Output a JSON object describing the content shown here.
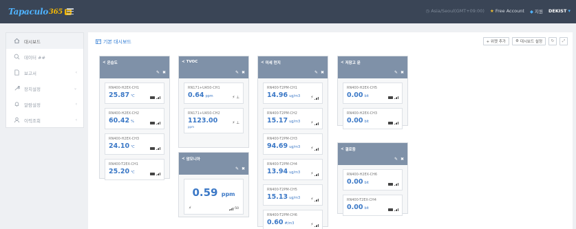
{
  "header": {
    "logo_text": "Tapaculo",
    "logo_glyph": "365",
    "logo_badge": "lo",
    "timezone": "Asia/Seoul(GMT+09:00)",
    "account": "Free Account",
    "support": "지원",
    "user": "DEKIST"
  },
  "sidebar": {
    "items": [
      {
        "label": "대시보드",
        "icon": "home-icon",
        "active": true
      },
      {
        "label": "데이터 ##",
        "icon": "search-icon"
      },
      {
        "label": "보고서",
        "icon": "document-icon"
      },
      {
        "label": "장치설정",
        "icon": "wrench-icon"
      },
      {
        "label": "알람설정",
        "icon": "bell-icon"
      },
      {
        "label": "이력조회",
        "icon": "user-icon"
      }
    ]
  },
  "main": {
    "title": "기본 대시보드",
    "buttons": {
      "add_widget": "+ 위젯 추가",
      "dashboard_settings": "대시보드 설정"
    }
  },
  "widgets": {
    "temp": {
      "title": "온습도",
      "sensors": [
        {
          "name": "RN400-H2EX-CH1",
          "value": "25.87",
          "unit": "℃"
        },
        {
          "name": "RN400-H2EX-CH2",
          "value": "60.42",
          "unit": "%"
        },
        {
          "name": "RN400-H2EX-CH3",
          "value": "24.10",
          "unit": "℃"
        },
        {
          "name": "RN400-T2EX-CH1",
          "value": "25.20",
          "unit": "℃"
        }
      ]
    },
    "tvoc": {
      "title": "TVOC",
      "sensors": [
        {
          "name": "RN171+UA50-CH1",
          "value": "0.64",
          "unit": "ppm"
        },
        {
          "name": "RN171+UA50-CH2",
          "value": "1123.00",
          "unit": "",
          "sub": "ppm"
        }
      ]
    },
    "ammonia": {
      "title": "암모니아",
      "value": "0.59",
      "unit": "ppm",
      "signal": "-50"
    },
    "dust": {
      "title": "미세 먼지",
      "sensors": [
        {
          "name": "RN400-T2PM-CH1",
          "value": "14.96",
          "unit": "ug/m3"
        },
        {
          "name": "RN400-T2PM-CH2",
          "value": "15.17",
          "unit": "ug/m3"
        },
        {
          "name": "RN400-T2PM-CH3",
          "value": "94.69",
          "unit": "ug/m3"
        },
        {
          "name": "RN400-T2PM-CH4",
          "value": "13.94",
          "unit": "ug/m3"
        },
        {
          "name": "RN400-T2PM-CH5",
          "value": "15.13",
          "unit": "ug/m3"
        },
        {
          "name": "RN400-T2PM-CH6",
          "value": "0.60",
          "unit": "#/m3"
        }
      ]
    },
    "storage": {
      "title": "저장고 문",
      "sensors": [
        {
          "name": "RN400-H2EX-CH5",
          "value": "0.00",
          "unit": "bit"
        },
        {
          "name": "RN400-H2EX-CH3",
          "value": "0.00",
          "unit": "bit"
        }
      ]
    },
    "flood": {
      "title": "결로등",
      "sensors": [
        {
          "name": "RN400-H2EX-CH6",
          "value": "0.00",
          "unit": "bit"
        },
        {
          "name": "RN400-T2EX-CH4",
          "value": "0.00",
          "unit": "bit"
        }
      ]
    }
  }
}
